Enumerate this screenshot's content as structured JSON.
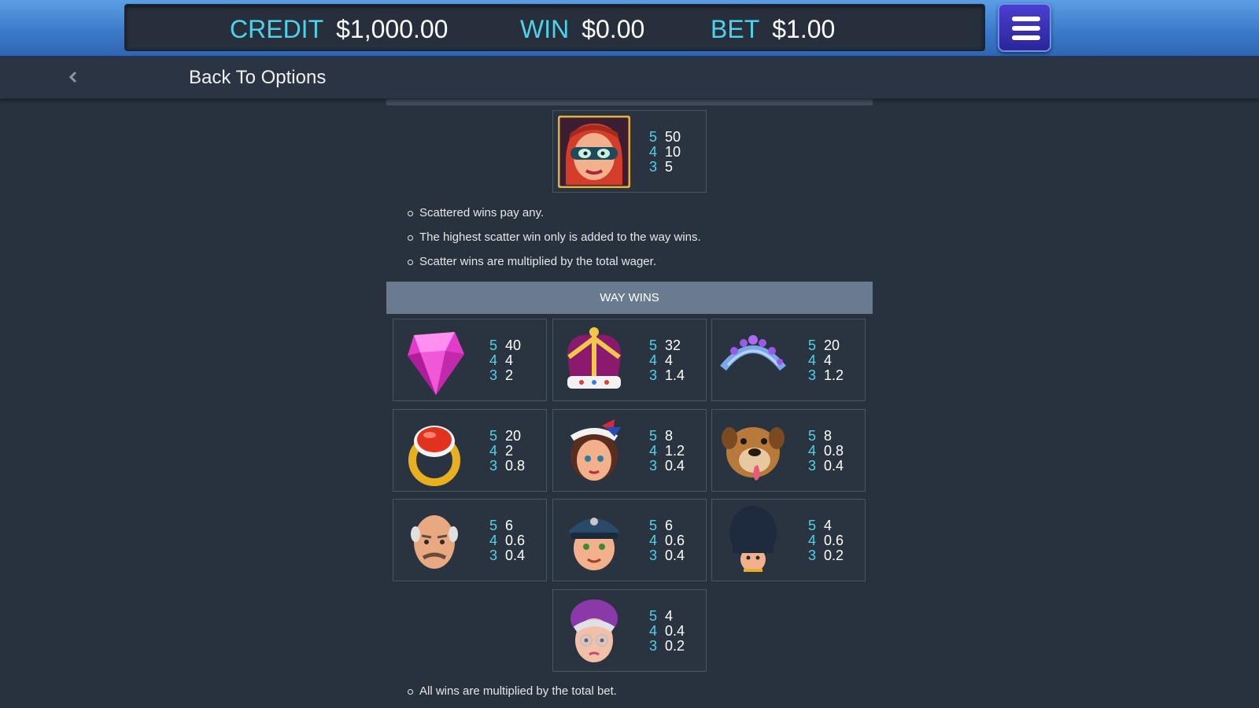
{
  "balance": {
    "credit_label": "CREDIT",
    "credit_value": "$1,000.00",
    "win_label": "WIN",
    "win_value": "$0.00",
    "bet_label": "BET",
    "bet_value": "$1.00"
  },
  "nav": {
    "back_label": "Back To Options"
  },
  "scatter": {
    "symbol": "masked-thief-woman-icon",
    "pays": [
      {
        "count": "5",
        "amount": "50"
      },
      {
        "count": "4",
        "amount": "10"
      },
      {
        "count": "3",
        "amount": "5"
      }
    ],
    "rules": [
      "Scattered wins pay any.",
      "The highest scatter win only is added to the way wins.",
      "Scatter wins are multiplied by the total wager."
    ]
  },
  "way_wins": {
    "title": "WAY WINS",
    "symbols": [
      {
        "symbol": "pink-gem-icon",
        "pays": [
          {
            "count": "5",
            "amount": "40"
          },
          {
            "count": "4",
            "amount": "4"
          },
          {
            "count": "3",
            "amount": "2"
          }
        ]
      },
      {
        "symbol": "royal-crown-icon",
        "pays": [
          {
            "count": "5",
            "amount": "32"
          },
          {
            "count": "4",
            "amount": "4"
          },
          {
            "count": "3",
            "amount": "1.4"
          }
        ]
      },
      {
        "symbol": "tiara-icon",
        "pays": [
          {
            "count": "5",
            "amount": "20"
          },
          {
            "count": "4",
            "amount": "4"
          },
          {
            "count": "3",
            "amount": "1.2"
          }
        ]
      },
      {
        "symbol": "ruby-ring-icon",
        "pays": [
          {
            "count": "5",
            "amount": "20"
          },
          {
            "count": "4",
            "amount": "2"
          },
          {
            "count": "3",
            "amount": "0.8"
          }
        ]
      },
      {
        "symbol": "girl-with-bow-icon",
        "pays": [
          {
            "count": "5",
            "amount": "8"
          },
          {
            "count": "4",
            "amount": "1.2"
          },
          {
            "count": "3",
            "amount": "0.4"
          }
        ]
      },
      {
        "symbol": "bulldog-icon",
        "pays": [
          {
            "count": "5",
            "amount": "8"
          },
          {
            "count": "4",
            "amount": "0.8"
          },
          {
            "count": "3",
            "amount": "0.4"
          }
        ]
      },
      {
        "symbol": "bald-man-icon",
        "pays": [
          {
            "count": "5",
            "amount": "6"
          },
          {
            "count": "4",
            "amount": "0.6"
          },
          {
            "count": "3",
            "amount": "0.4"
          }
        ]
      },
      {
        "symbol": "police-officer-icon",
        "pays": [
          {
            "count": "5",
            "amount": "6"
          },
          {
            "count": "4",
            "amount": "0.6"
          },
          {
            "count": "3",
            "amount": "0.4"
          }
        ]
      },
      {
        "symbol": "royal-guard-icon",
        "pays": [
          {
            "count": "5",
            "amount": "4"
          },
          {
            "count": "4",
            "amount": "0.6"
          },
          {
            "count": "3",
            "amount": "0.2"
          }
        ]
      },
      {
        "symbol": "old-lady-icon",
        "pays": [
          {
            "count": "5",
            "amount": "4"
          },
          {
            "count": "4",
            "amount": "0.4"
          },
          {
            "count": "3",
            "amount": "0.2"
          }
        ]
      }
    ],
    "rules": [
      "All wins are multiplied by the total bet."
    ]
  }
}
